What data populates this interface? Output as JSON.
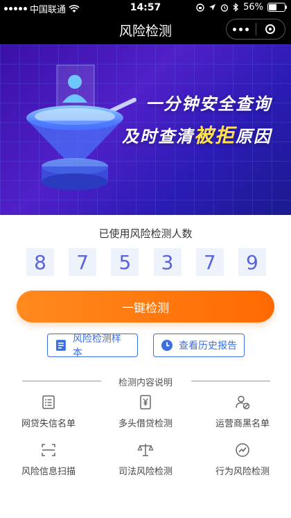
{
  "status": {
    "carrier": "中国联通",
    "time": "14:57",
    "battery": "56%",
    "battery_level": 0.56
  },
  "nav": {
    "title": "风险检测"
  },
  "banner": {
    "line1": "一分钟安全查询",
    "line2_prefix": "及时查清",
    "line2_highlight": "被拒",
    "line2_suffix": "原因",
    "highlight_color": "#ffe24d"
  },
  "counter": {
    "label": "已使用风险检测人数",
    "digits": [
      "8",
      "7",
      "5",
      "3",
      "7",
      "9"
    ]
  },
  "actions": {
    "main_label": "一键检测",
    "sample_label": "风险检测样本",
    "history_label": "查看历史报告"
  },
  "section": {
    "title": "检测内容说明"
  },
  "features": [
    {
      "label": "网贷失信名单",
      "icon": "list-icon"
    },
    {
      "label": "多头借贷检测",
      "icon": "yuan-icon"
    },
    {
      "label": "运营商黑名单",
      "icon": "user-block-icon"
    },
    {
      "label": "风险信息扫描",
      "icon": "scan-icon"
    },
    {
      "label": "司法风险检测",
      "icon": "scale-icon"
    },
    {
      "label": "行为风险检测",
      "icon": "trend-icon"
    }
  ],
  "colors": {
    "accent_orange": "#ff7a0f",
    "accent_blue": "#3b6fe0",
    "digit_color": "#5a63d8"
  }
}
